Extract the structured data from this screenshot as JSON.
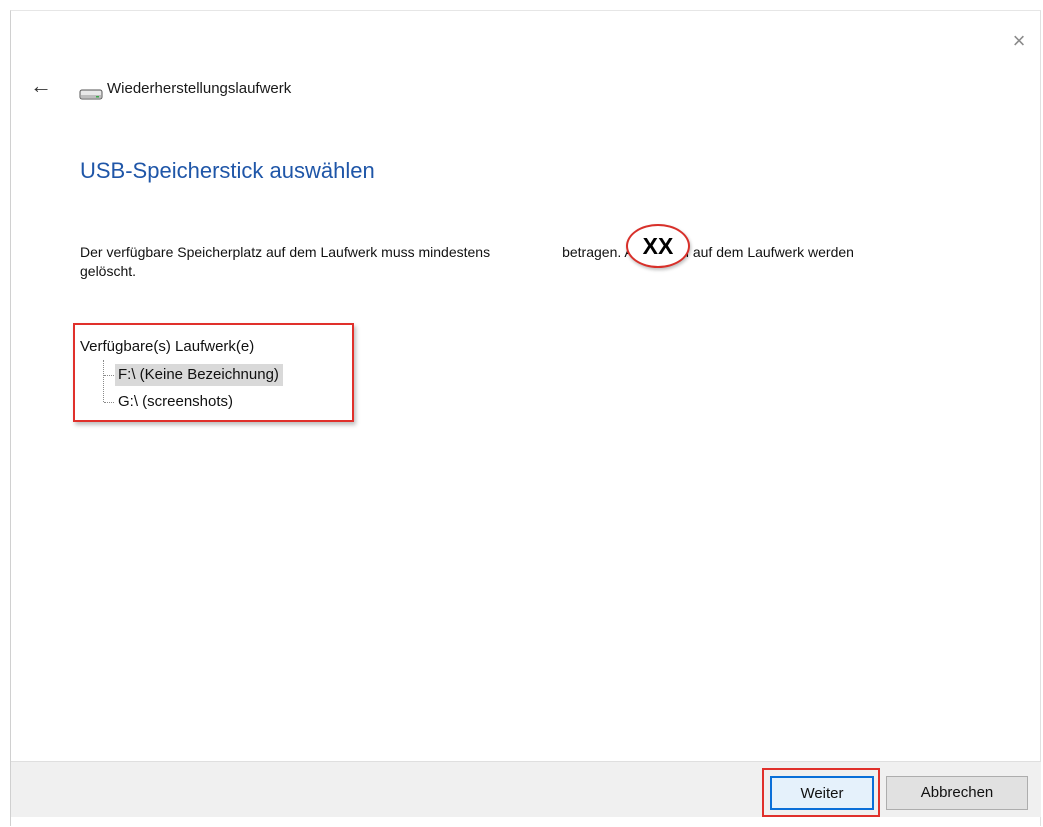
{
  "window": {
    "title": "Wiederherstellungslaufwerk",
    "close_glyph": "×",
    "back_glyph": "←"
  },
  "page": {
    "heading": "USB-Speicherstick auswählen",
    "description_before": "Der verfügbare Speicherplatz auf dem Laufwerk muss mindestens",
    "description_size": "XX",
    "description_after": "betragen. Alle Daten auf dem Laufwerk werden gelöscht."
  },
  "drives": {
    "label": "Verfügbare(s) Laufwerk(e)",
    "items": [
      {
        "label": "F:\\ (Keine Bezeichnung)",
        "selected": true
      },
      {
        "label": "G:\\ (screenshots)",
        "selected": false
      }
    ]
  },
  "buttons": {
    "next_label": "Weiter",
    "cancel_label": "Abbrechen"
  },
  "colors": {
    "heading": "#1f56a8",
    "annotation_red": "#e0302b",
    "default_button_border": "#0a6fd8"
  },
  "icons": {
    "back": "back-arrow-icon",
    "drive": "drive-icon",
    "close": "close-icon"
  }
}
